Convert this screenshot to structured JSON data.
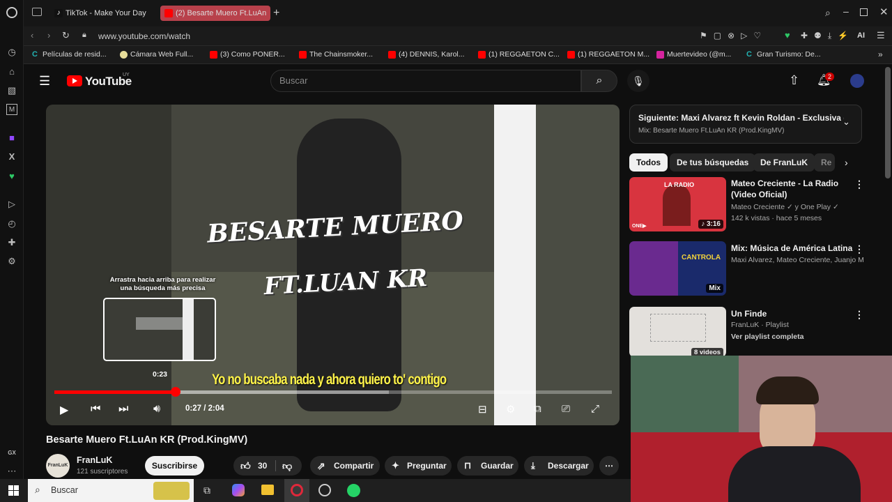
{
  "browser": {
    "tabs": [
      {
        "label": "TikTok - Make Your Day",
        "active": false
      },
      {
        "label": "(2) Besarte Muero Ft.LuAn",
        "active": true
      }
    ],
    "url": "www.youtube.com/watch",
    "ai_label": "AI",
    "bookmarks": [
      "Películas de resid...",
      "Cámara Web Full...",
      "(3) Como PONER...",
      "The Chainsmoker...",
      "(4) DENNIS, Karol...",
      "(1) REGGAETON C...",
      "(1) REGGAETON M...",
      "Muertevideo (@m...",
      "Gran Turismo: De..."
    ],
    "sidebar_bottom": "GX"
  },
  "youtube": {
    "logo_text": "YouTube",
    "country": "UY",
    "search_placeholder": "Buscar",
    "notif_count": "2"
  },
  "video": {
    "overlay_title_line1": "BESARTE MUERO",
    "overlay_title_line2": "FT.LUAN KR",
    "hint": "Arrastra hacia arriba para realizar una búsqueda más precisa",
    "hover_time": "0:23",
    "subtitle": "Yo no buscaba nada y ahora quiero to' contigo",
    "time": "0:27 / 2:04",
    "progress": 0.218,
    "preview_progress": 0.185,
    "title": "Besarte Muero Ft.LuAn KR (Prod.KingMV)",
    "channel": "FranLuK",
    "channel_avatar": "FranLuK",
    "subscribers": "121 suscriptores",
    "subscribe": "Suscribirse",
    "likes": "30",
    "share": "Compartir",
    "ask": "Preguntar",
    "save": "Guardar",
    "download": "Descargar"
  },
  "sidebar": {
    "next_title": "Siguiente: Maxi Alvarez ft Kevin Roldan - Exclusiva (...",
    "next_sub": "Mix: Besarte Muero Ft.LuAn KR (Prod.KingMV)",
    "chips": [
      "Todos",
      "De tus búsquedas",
      "De FranLuK",
      "Re"
    ],
    "videos": [
      {
        "title": "Mateo Creciente - La Radio (Video Oficial)",
        "meta1": "Mateo Creciente ✓ y One Play ✓",
        "meta2": "142 k vistas · hace 5 meses",
        "badge": "♪ 3:16",
        "thumb_text": "LA RADIO",
        "thumb_brand": "ONE▶"
      },
      {
        "title": "Mix: Música de América Latina",
        "meta1": "Maxi Alvarez, Mateo Creciente, Juanjo M...",
        "meta2": "",
        "badge": "Mix",
        "thumb_text": "CANTROLA"
      },
      {
        "title": "Un Finde",
        "meta1": "FranLuK · Playlist",
        "meta2": "Ver playlist completa",
        "badge": "8 videos"
      }
    ]
  },
  "taskbar": {
    "search": "Buscar"
  }
}
